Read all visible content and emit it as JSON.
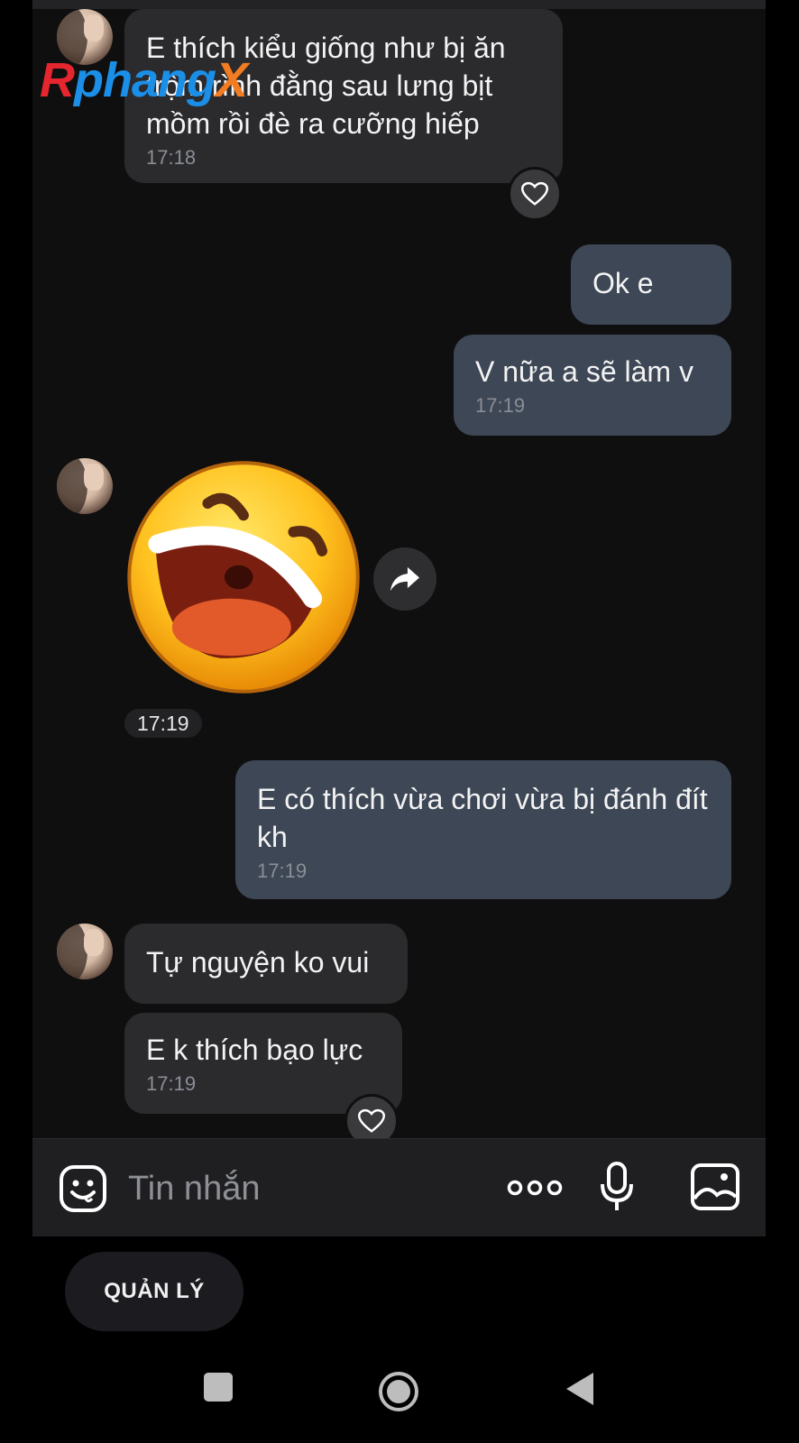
{
  "watermark": {
    "part1": "R",
    "part2": "phang",
    "part3": "X"
  },
  "messages": [
    {
      "text": "E thích kiểu giống như bị ăn trộm rình đằng sau lưng bịt mồm rồi đè ra cưỡng hiếp",
      "time": "17:18"
    },
    {
      "text": "Ok e"
    },
    {
      "text": "V nữa a sẽ làm v",
      "time": "17:19"
    },
    {
      "sticker": "laughing-face-sticker",
      "time": "17:19"
    },
    {
      "text": "E có thích vừa chơi vừa bị đánh đít kh",
      "time": "17:19"
    },
    {
      "text": "Tự nguyện ko vui"
    },
    {
      "text": "E k thích bạo lực",
      "time": "17:19"
    }
  ],
  "composer": {
    "placeholder": "Tin nhắn"
  },
  "manage_button": "QUẢN LÝ",
  "colors": {
    "incoming": "#2b2b2e",
    "outgoing": "#3e4756",
    "background": "#0f0f10"
  }
}
